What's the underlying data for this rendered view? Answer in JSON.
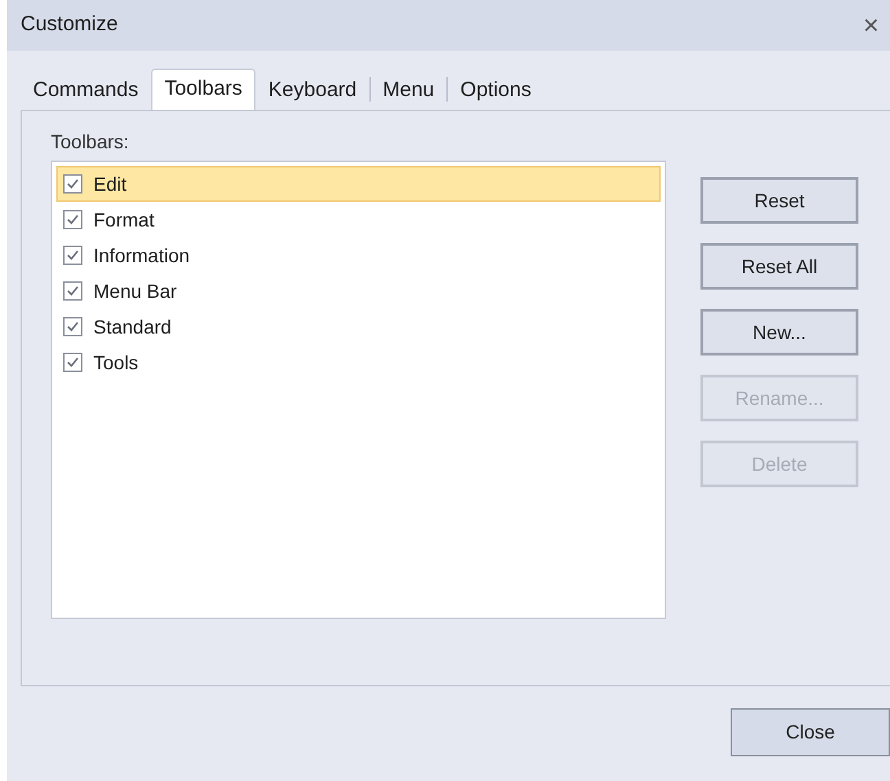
{
  "window": {
    "title": "Customize",
    "close_glyph": "×"
  },
  "tabs": [
    {
      "label": "Commands",
      "selected": false
    },
    {
      "label": "Toolbars",
      "selected": true
    },
    {
      "label": "Keyboard",
      "selected": false
    },
    {
      "label": "Menu",
      "selected": false
    },
    {
      "label": "Options",
      "selected": false
    }
  ],
  "list_label": "Toolbars:",
  "toolbars": [
    {
      "label": "Edit",
      "checked": true,
      "selected": true
    },
    {
      "label": "Format",
      "checked": true,
      "selected": false
    },
    {
      "label": "Information",
      "checked": true,
      "selected": false
    },
    {
      "label": "Menu Bar",
      "checked": true,
      "selected": false
    },
    {
      "label": "Standard",
      "checked": true,
      "selected": false
    },
    {
      "label": "Tools",
      "checked": true,
      "selected": false
    }
  ],
  "buttons": [
    {
      "label": "Reset",
      "disabled": false
    },
    {
      "label": "Reset All",
      "disabled": false
    },
    {
      "label": "New...",
      "disabled": false
    },
    {
      "label": "Rename...",
      "disabled": true
    },
    {
      "label": "Delete",
      "disabled": true
    }
  ],
  "close_button": "Close"
}
